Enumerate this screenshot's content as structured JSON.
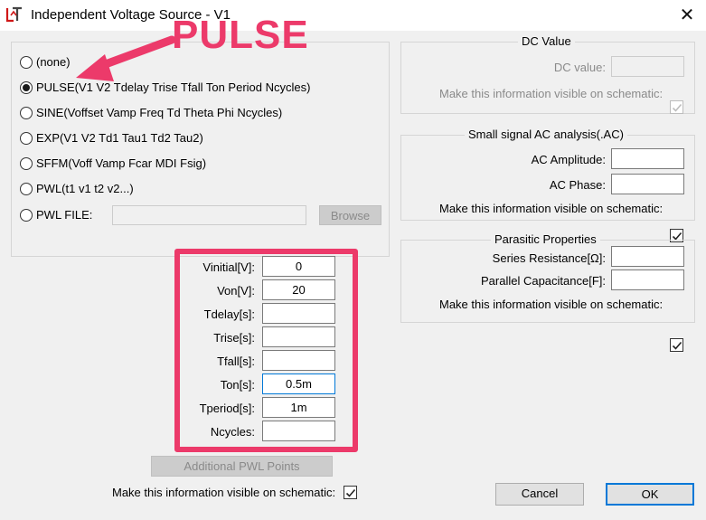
{
  "window": {
    "title": "Independent Voltage Source - V1",
    "close_glyph": "✕"
  },
  "annotation": {
    "label": "PULSE",
    "color": "#ec3a6a"
  },
  "functions": {
    "options": [
      {
        "label": "(none)",
        "selected": false
      },
      {
        "label": "PULSE(V1 V2 Tdelay Trise Tfall Ton Period Ncycles)",
        "selected": true
      },
      {
        "label": "SINE(Voffset Vamp Freq Td Theta Phi Ncycles)",
        "selected": false
      },
      {
        "label": "EXP(V1 V2 Td1 Tau1 Td2 Tau2)",
        "selected": false
      },
      {
        "label": "SFFM(Voff Vamp Fcar MDI Fsig)",
        "selected": false
      },
      {
        "label": "PWL(t1 v1 t2 v2...)",
        "selected": false
      },
      {
        "label": "PWL FILE:",
        "selected": false
      }
    ],
    "pwl_file_value": "",
    "browse_label": "Browse"
  },
  "pulse_params": [
    {
      "label": "Vinitial[V]:",
      "value": "0"
    },
    {
      "label": "Von[V]:",
      "value": "20"
    },
    {
      "label": "Tdelay[s]:",
      "value": ""
    },
    {
      "label": "Trise[s]:",
      "value": ""
    },
    {
      "label": "Tfall[s]:",
      "value": ""
    },
    {
      "label": "Ton[s]:",
      "value": "0.5m"
    },
    {
      "label": "Tperiod[s]:",
      "value": "1m"
    },
    {
      "label": "Ncycles:",
      "value": ""
    }
  ],
  "additional_pwl_label": "Additional PWL Points",
  "visible_on_schematic_label": "Make this information visible on schematic:",
  "dc": {
    "title": "DC Value",
    "value_label": "DC value:",
    "value": "",
    "visible_label": "Make this information visible on schematic:"
  },
  "ac": {
    "title": "Small signal AC analysis(.AC)",
    "amplitude_label": "AC Amplitude:",
    "amplitude": "",
    "phase_label": "AC Phase:",
    "phase": "",
    "visible_label": "Make this information visible on schematic:"
  },
  "parasitic": {
    "title": "Parasitic Properties",
    "series_label": "Series Resistance[Ω]:",
    "series": "",
    "parallel_label": "Parallel Capacitance[F]:",
    "parallel": "",
    "visible_label": "Make this information visible on schematic:"
  },
  "buttons": {
    "cancel": "Cancel",
    "ok": "OK"
  }
}
